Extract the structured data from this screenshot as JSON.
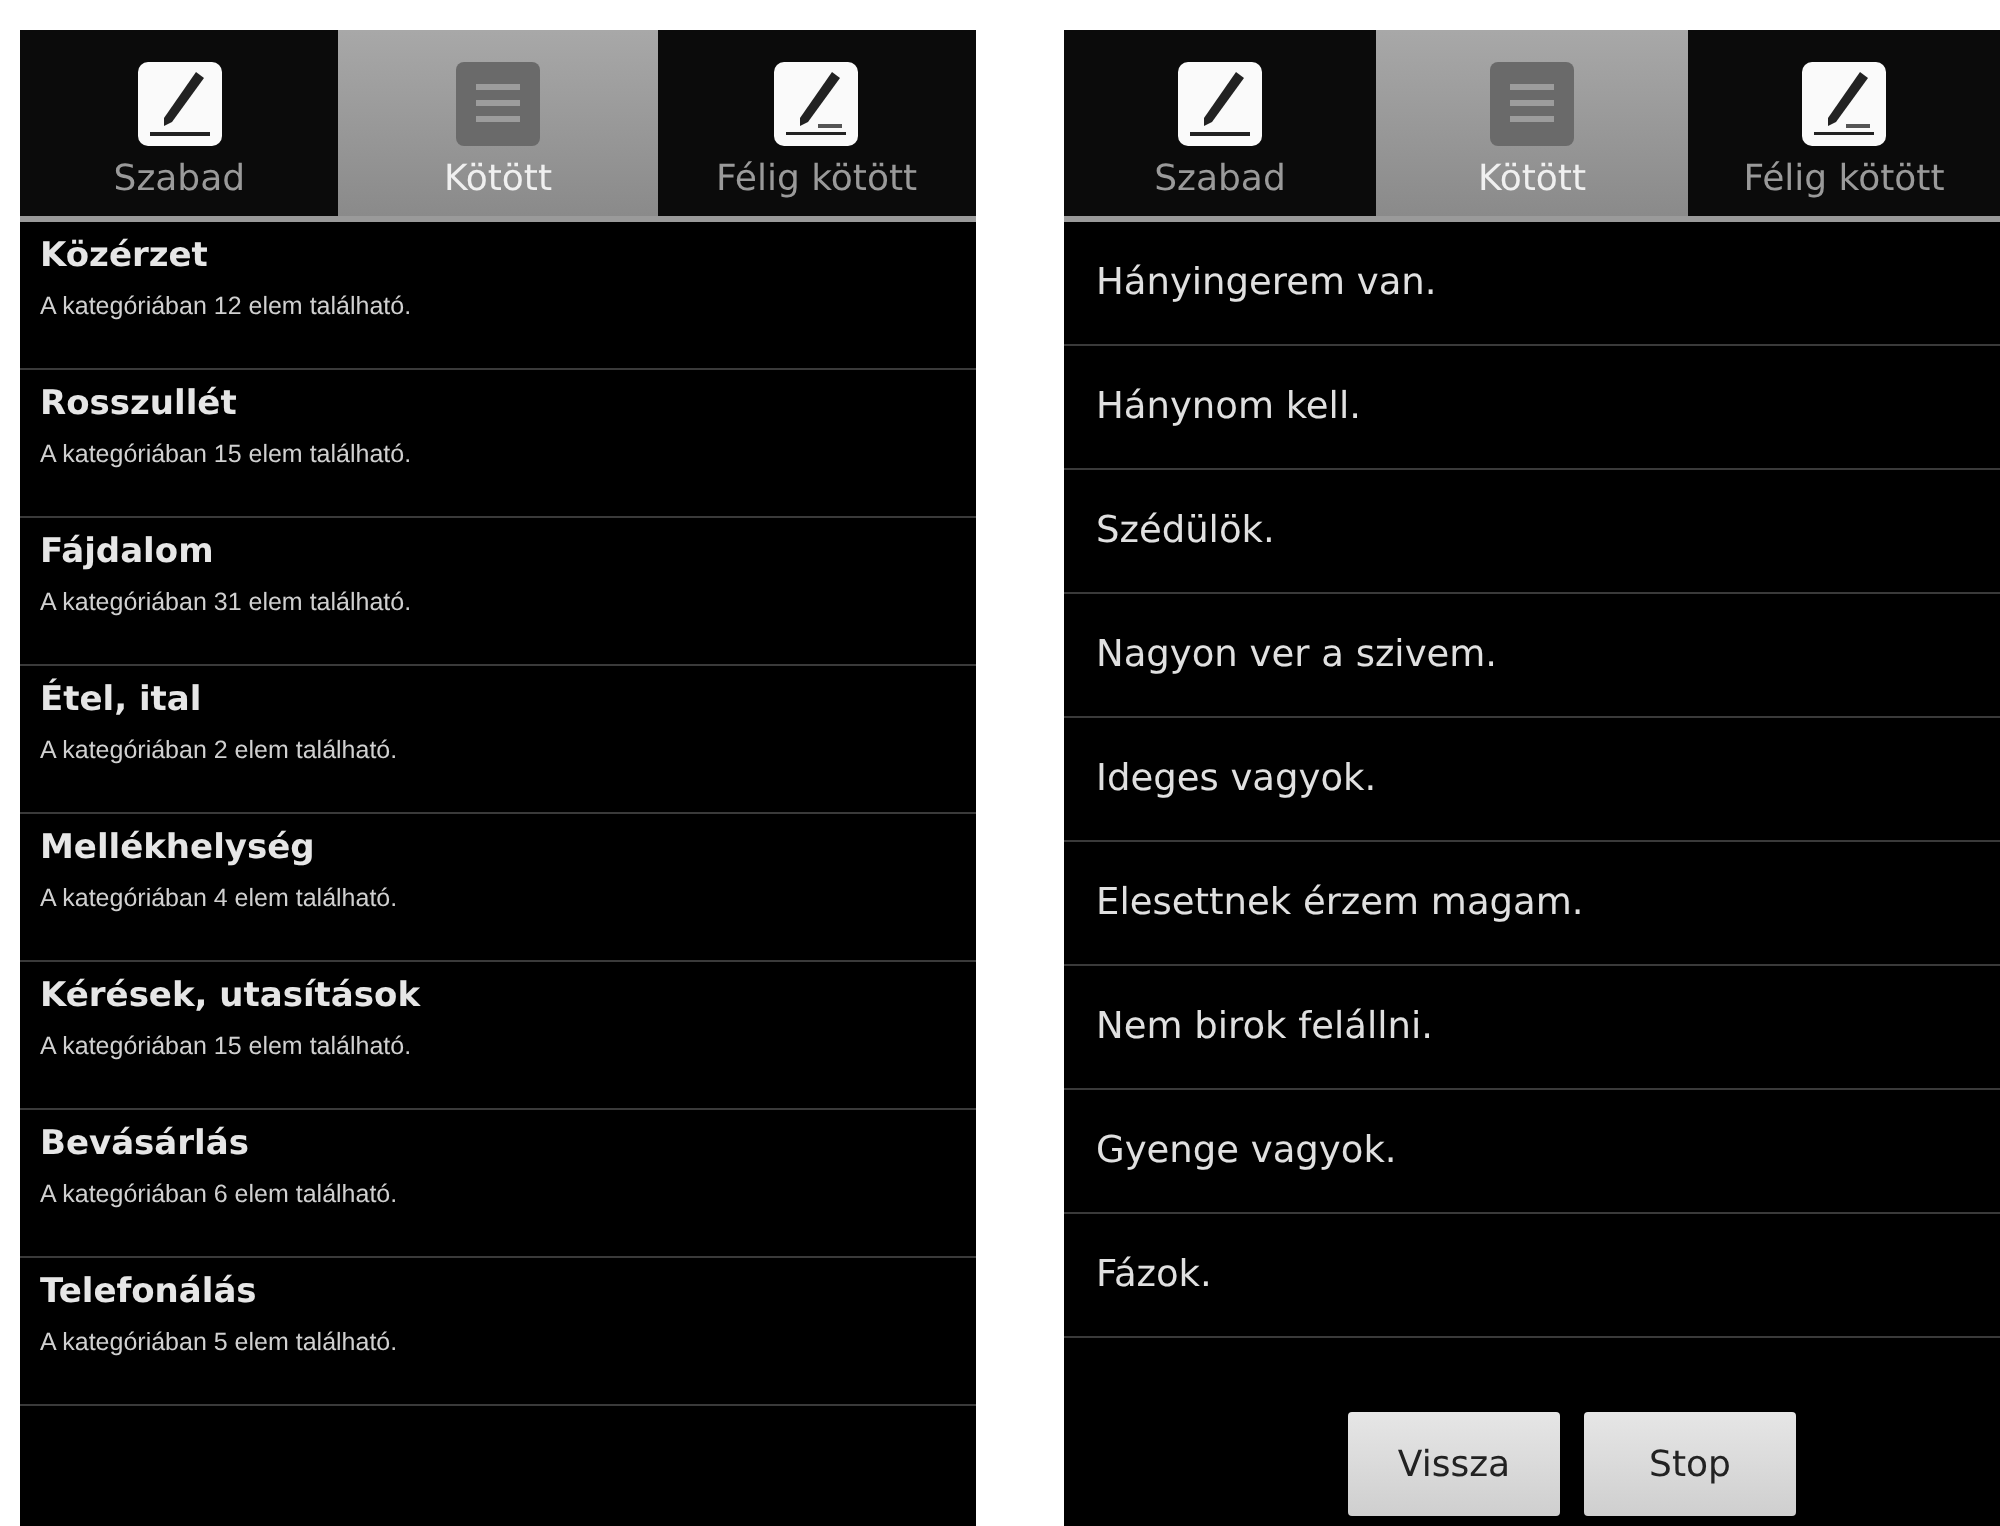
{
  "screens": [
    {
      "tabs": [
        {
          "label": "Szabad",
          "kind": "pencil",
          "selected": false
        },
        {
          "label": "Kötött",
          "kind": "list",
          "selected": true
        },
        {
          "label": "Félig kötött",
          "kind": "pencil-line",
          "selected": false
        }
      ],
      "categories": [
        {
          "title": "Közérzet",
          "subtitle": "A kategóriában 12 elem található."
        },
        {
          "title": "Rosszullét",
          "subtitle": "A kategóriában 15 elem található."
        },
        {
          "title": "Fájdalom",
          "subtitle": "A kategóriában 31 elem található."
        },
        {
          "title": "Étel, ital",
          "subtitle": "A kategóriában 2 elem található."
        },
        {
          "title": "Mellékhelység",
          "subtitle": "A kategóriában 4 elem található."
        },
        {
          "title": "Kérések, utasítások",
          "subtitle": "A kategóriában 15 elem található."
        },
        {
          "title": "Bevásárlás",
          "subtitle": "A kategóriában 6 elem található."
        },
        {
          "title": "Telefonálás",
          "subtitle": "A kategóriában 5 elem található."
        }
      ]
    },
    {
      "tabs": [
        {
          "label": "Szabad",
          "kind": "pencil",
          "selected": false
        },
        {
          "label": "Kötött",
          "kind": "list",
          "selected": true
        },
        {
          "label": "Félig kötött",
          "kind": "pencil-line",
          "selected": false
        }
      ],
      "phrases": [
        "Hányingerem van.",
        "Hánynom kell.",
        "Szédülök.",
        "Nagyon ver a szivem.",
        "Ideges vagyok.",
        "Elesettnek érzem magam.",
        "Nem birok felállni.",
        "Gyenge vagyok.",
        "Fázok."
      ],
      "buttons": [
        "Vissza",
        "Stop"
      ]
    }
  ]
}
